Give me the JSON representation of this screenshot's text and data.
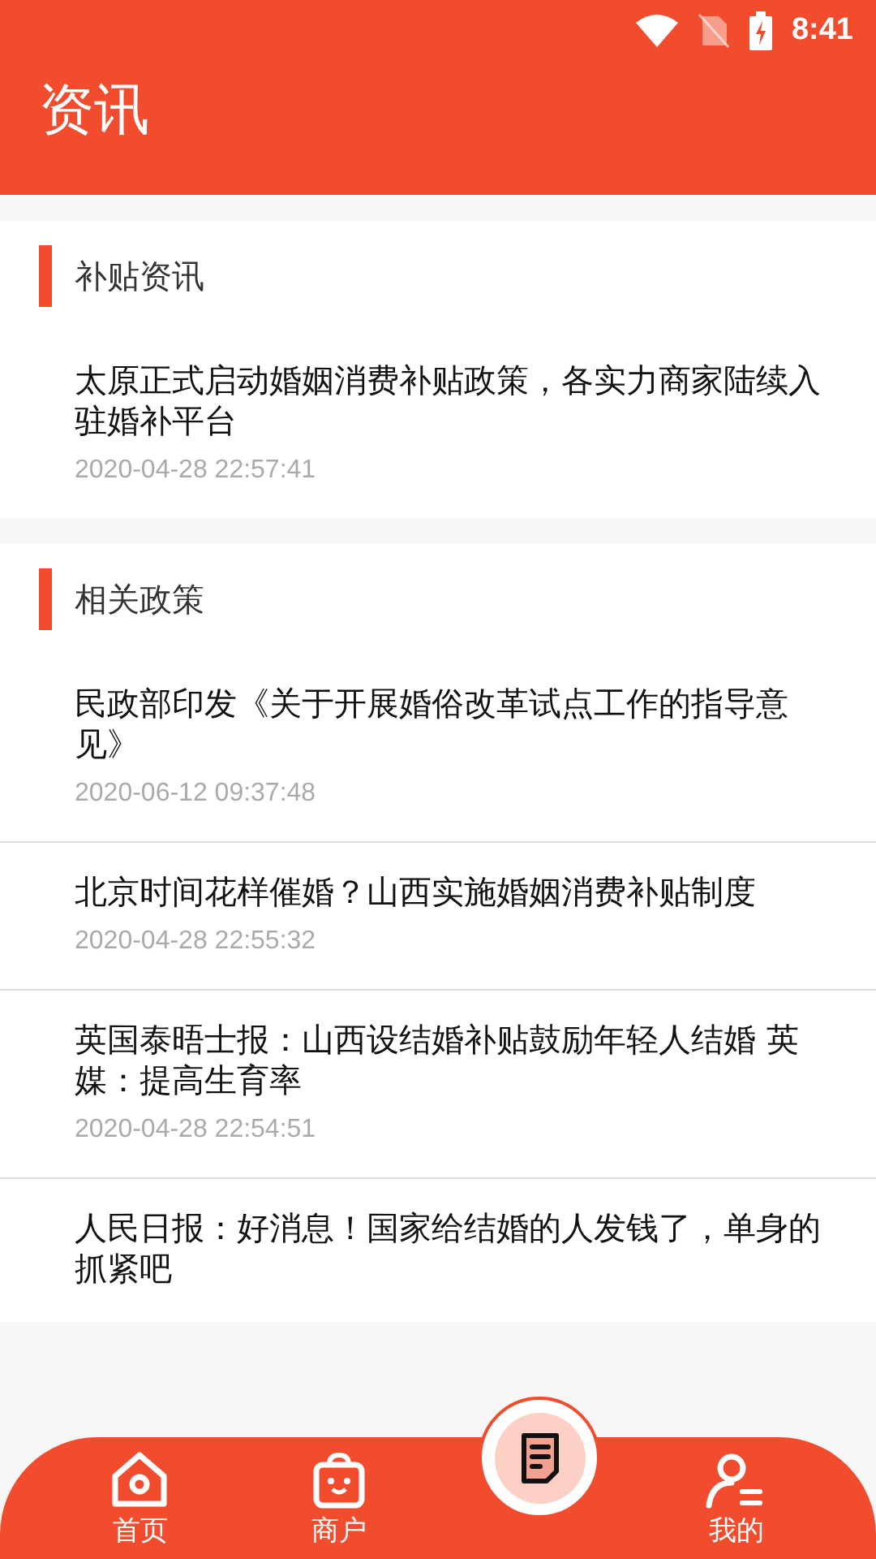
{
  "status_bar": {
    "time": "8:41"
  },
  "header": {
    "title": "资讯"
  },
  "sections": [
    {
      "title": "补贴资讯",
      "articles": [
        {
          "title": "太原正式启动婚姻消费补贴政策，各实力商家陆续入驻婚补平台",
          "date": "2020-04-28 22:57:41"
        }
      ]
    },
    {
      "title": "相关政策",
      "articles": [
        {
          "title": "民政部印发《关于开展婚俗改革试点工作的指导意见》",
          "date": "2020-06-12 09:37:48"
        },
        {
          "title": "北京时间花样催婚？山西实施婚姻消费补贴制度",
          "date": "2020-04-28 22:55:32"
        },
        {
          "title": "英国泰晤士报：山西设结婚补贴鼓励年轻人结婚 英媒：提高生育率",
          "date": "2020-04-28 22:54:51"
        },
        {
          "title": "人民日报：好消息！国家给结婚的人发钱了，单身的抓紧吧"
        }
      ]
    }
  ],
  "bottom_nav": [
    {
      "kind": "home",
      "label": "首页"
    },
    {
      "kind": "shop",
      "label": "商户"
    },
    {
      "kind": "center"
    },
    {
      "kind": "profile",
      "label": "我的"
    }
  ]
}
